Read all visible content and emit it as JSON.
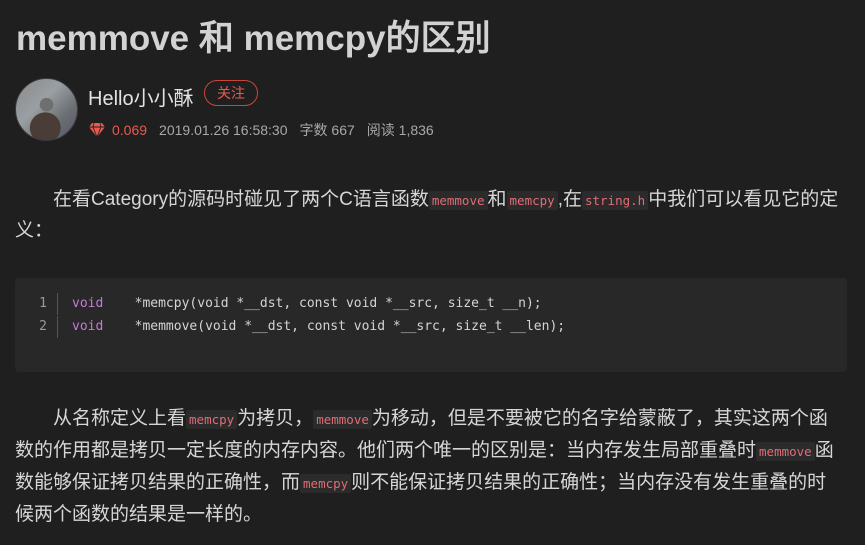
{
  "article": {
    "title": "memmove 和 memcpy的区别"
  },
  "author": {
    "name": "Hello小小酥",
    "follow_label": "关注",
    "score": "0.069",
    "date": "2019.01.26 16:58:30",
    "word_count": "字数 667",
    "read_count": "阅读 1,836",
    "accent_color": "#e85a4f"
  },
  "para1": {
    "t1": "在看Category的源码时碰见了两个C语言函数",
    "c1": "memmove",
    "t2": "和",
    "c2": "memcpy",
    "t3": ",在",
    "c3": "string.h",
    "t4": "中我们可以看见它的定义："
  },
  "code": {
    "lines": [
      {
        "num": "1",
        "kw": "void",
        "name": "*memcpy",
        "args": "(void *__dst, const void *__src, size_t __n);"
      },
      {
        "num": "2",
        "kw": "void",
        "name": "*memmove",
        "args": "(void *__dst, const void *__src, size_t __len);"
      }
    ]
  },
  "para2": {
    "t1": "从名称定义上看",
    "c1": "memcpy",
    "t2": "为拷贝，",
    "c2": "memmove",
    "t3": "为移动，但是不要被它的名字给蒙蔽了，其实这两个函数的作用都是拷贝一定长度的内存内容。他们两个唯一的区别是：当内存发生局部重叠时",
    "c3": "memmove",
    "t4": "函数能够保证拷贝结果的正确性，而",
    "c4": "memcpy",
    "t5": "则不能保证拷贝结果的正确性；当内存没有发生重叠的时候两个函数的结果是一样的。"
  }
}
